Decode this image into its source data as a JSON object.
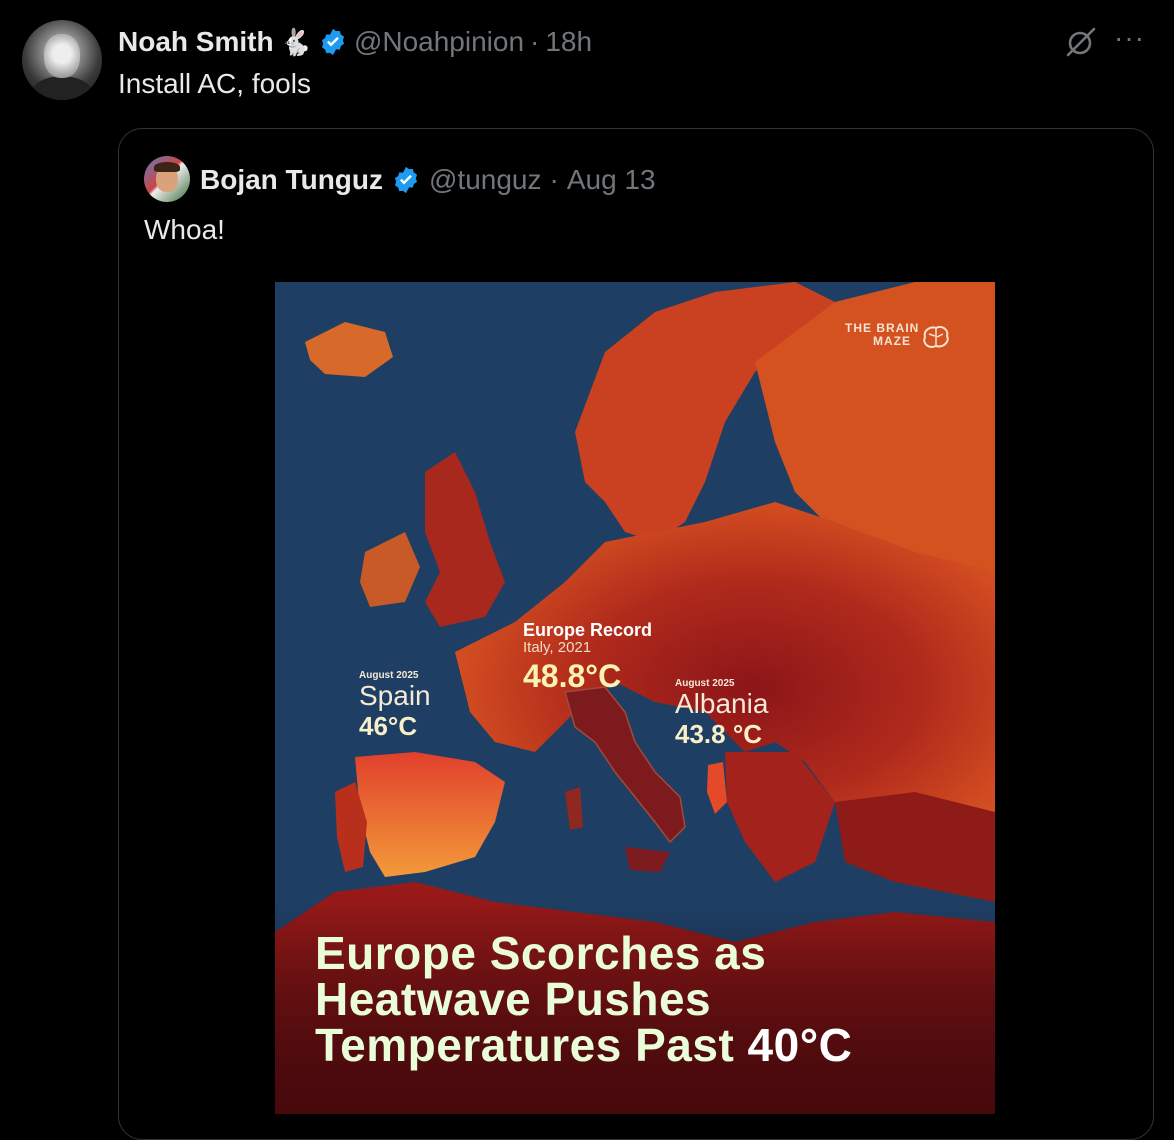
{
  "tweet": {
    "author_name": "Noah Smith",
    "author_emoji": "🐇",
    "handle": "@Noahpinion",
    "separator": "·",
    "time": "18h",
    "text": "Install AC, fools",
    "icons": [
      "grok-icon",
      "more-icon"
    ]
  },
  "quoted": {
    "author_name": "Bojan Tunguz",
    "handle": "@tunguz",
    "separator": "·",
    "time": "Aug 13",
    "text": "Whoa!"
  },
  "infographic": {
    "brand_line1": "THE BRAIN",
    "brand_line2": "MAZE",
    "spain": {
      "date": "August 2025",
      "country": "Spain",
      "temp": "46°C"
    },
    "italy": {
      "title": "Europe Record",
      "subtitle": "Italy, 2021",
      "temp": "48.8°C"
    },
    "albania": {
      "date": "August 2025",
      "country": "Albania",
      "temp": "43.8 °C"
    },
    "headline": {
      "line1": "Europe Scorches as",
      "line2": "Heatwave Pushes",
      "line3_a": "Temperatures Past ",
      "line3_b": "40°C"
    }
  },
  "colors": {
    "background": "#000000",
    "text": "#e7e9ea",
    "muted": "#71767b",
    "verified": "#1d9bf0",
    "sea": "#1e3e63",
    "land_hot": "#c8431f",
    "land_dark": "#7a1216"
  }
}
